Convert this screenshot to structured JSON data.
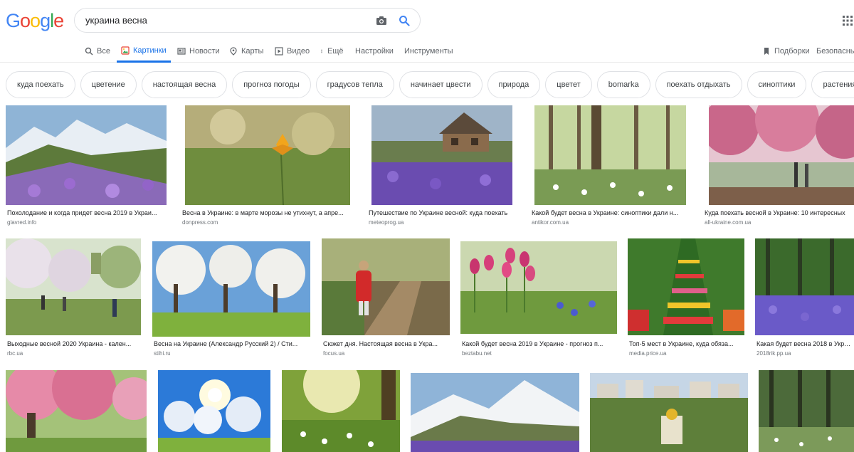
{
  "logo": "Google",
  "search": {
    "query": "украина весна"
  },
  "tabs": [
    {
      "label": "Все",
      "icon": "search-icon"
    },
    {
      "label": "Картинки",
      "icon": "image-icon"
    },
    {
      "label": "Новости",
      "icon": "news-icon"
    },
    {
      "label": "Карты",
      "icon": "map-pin-icon"
    },
    {
      "label": "Видео",
      "icon": "play-icon"
    },
    {
      "label": "Ещё",
      "icon": "more-vert-icon"
    },
    {
      "label": "Настройки"
    },
    {
      "label": "Инструменты"
    }
  ],
  "right_tabs": {
    "bookmarks": "Подборки",
    "safe": "Безопасны"
  },
  "chips": [
    "куда поехать",
    "цветение",
    "настоящая весна",
    "прогноз погоды",
    "градусов тепла",
    "начинает цвести",
    "природа",
    "цветет",
    "bomarka",
    "поехать отдыхать",
    "синоптики",
    "растения"
  ],
  "results": [
    {
      "caption": "Похолодание и когда придет весна 2019 в Украи...",
      "source": "glavred.info"
    },
    {
      "caption": "Весна в Украине: в марте морозы не утихнут, а апре...",
      "source": "donpress.com"
    },
    {
      "caption": "Путешествие по Украине весной: куда поехать",
      "source": "meteoprog.ua"
    },
    {
      "caption": "Какой будет весна в Украине: синоптики дали н...",
      "source": "antikor.com.ua"
    },
    {
      "caption": "Куда поехать весной в Украине: 10 интересных",
      "source": "all-ukraine.com.ua"
    },
    {
      "caption": "Выходные весной 2020 Украина - кален...",
      "source": "rbc.ua"
    },
    {
      "caption": "Весна на Украине (Александр Русский 2) / Сти...",
      "source": "stihi.ru"
    },
    {
      "caption": "Сюжет дня. Настоящая весна в Укра...",
      "source": "focus.ua"
    },
    {
      "caption": "Какой будет весна 2019 в Украине - прогноз п...",
      "source": "beztabu.net"
    },
    {
      "caption": "Топ-5 мест в Украине, куда обяза...",
      "source": "media.price.ua"
    },
    {
      "caption": "Какая будет весна 2018 в Украи...",
      "source": "2018rik.pp.ua"
    }
  ],
  "colors": {
    "accent": "#1a73e8",
    "chip_border": "#dfe1e5",
    "muted": "#70757a"
  }
}
